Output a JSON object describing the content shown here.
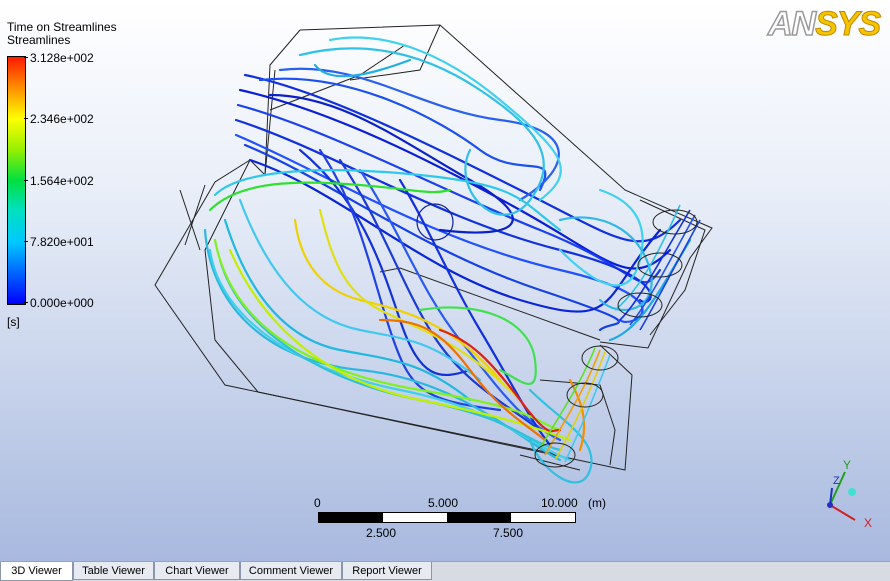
{
  "legend": {
    "title": "Time on Streamlines",
    "subtitle": "Streamlines",
    "ticks": [
      "3.128e+002",
      "2.346e+002",
      "1.564e+002",
      "7.820e+001",
      "0.000e+000"
    ],
    "unit": "[s]"
  },
  "logo": {
    "part1": "AN",
    "part2": "SYS"
  },
  "scale": {
    "top_labels": [
      "0",
      "5.000",
      "10.000"
    ],
    "bottom_labels": [
      "2.500",
      "7.500"
    ],
    "unit": "(m)"
  },
  "axes": {
    "x": "X",
    "y": "Y",
    "z": "Z"
  },
  "tabs": [
    {
      "label": "3D Viewer",
      "active": true
    },
    {
      "label": "Table Viewer",
      "active": false
    },
    {
      "label": "Chart Viewer",
      "active": false
    },
    {
      "label": "Comment Viewer",
      "active": false
    },
    {
      "label": "Report Viewer",
      "active": false
    }
  ],
  "colors": {
    "max": "#ff1a00",
    "mid": "#00e040",
    "min": "#0000ff"
  }
}
